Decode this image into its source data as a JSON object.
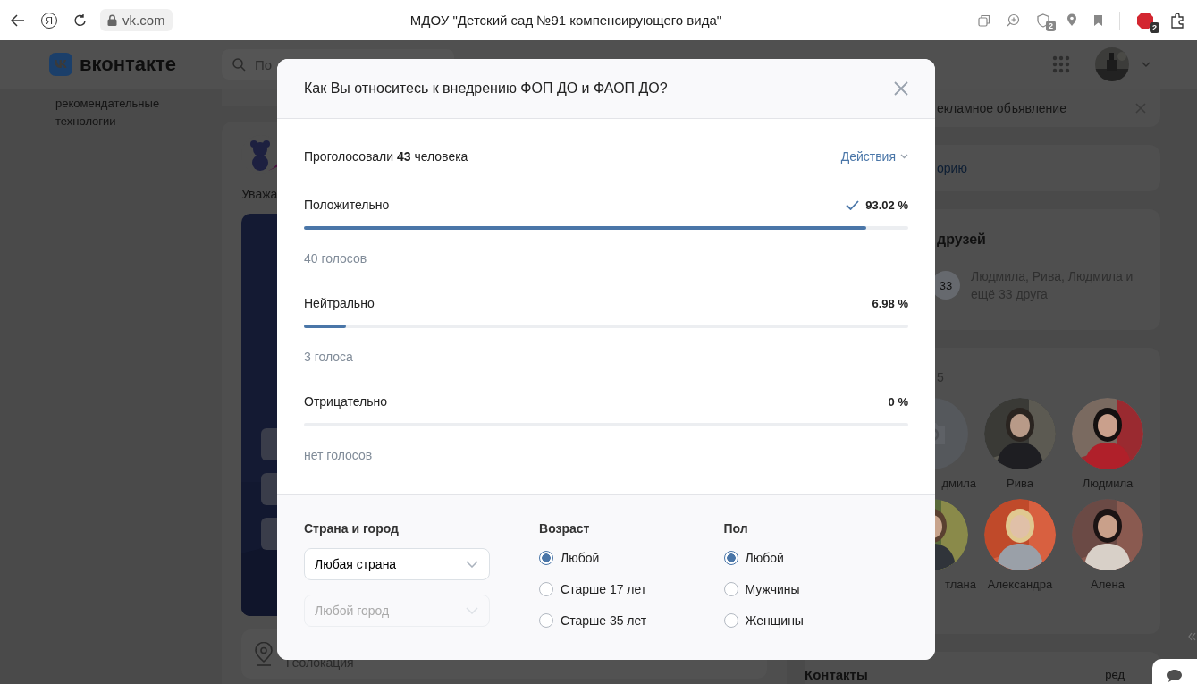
{
  "browser": {
    "home_glyph": "Я",
    "address": "vk.com",
    "title": "МДОУ \"Детский сад №91 компенсирующего вида\"",
    "shield_badge": "2",
    "extension_badge": "2"
  },
  "vk_header": {
    "logo": "вконтакте",
    "search_placeholder": "По"
  },
  "left_note": "рекомендательные технологии",
  "feed": {
    "author_snippet": "Уважа",
    "geo_label": "Геолокация"
  },
  "right": {
    "ad_text": "екламное объявление",
    "story_link": "орию",
    "friends_title": "друзей",
    "more_badge": "33",
    "friends_names": "Людмила, Рива, Людмила и ещё 33 друга",
    "friends_count": "5",
    "friends": [
      {
        "name": "дмила",
        "kind": "placeholder"
      },
      {
        "name": "Рива"
      },
      {
        "name": "Людмила"
      },
      {
        "name": "тлана"
      },
      {
        "name": "Александра"
      },
      {
        "name": "Алена"
      }
    ],
    "contacts_title": "Контакты",
    "contacts_edit": "ред"
  },
  "poll": {
    "question": "Как Вы относитесь к внедрению ФОП ДО и ФАОП ДО?",
    "summary": "Проголосовали **43** человека",
    "actions": "Действия",
    "answers": [
      {
        "label": "Положительно",
        "percent": "93.02 %",
        "level": 0.9302,
        "votes": "40 голосов",
        "voted": true
      },
      {
        "label": "Нейтрально",
        "percent": "6.98 %",
        "level": 0.0698,
        "votes": "3 голоса",
        "voted": false
      },
      {
        "label": "Отрицательно",
        "percent": "0 %",
        "level": 0,
        "votes": "нет голосов",
        "voted": false
      }
    ],
    "filters": {
      "location": {
        "title": "Страна и город",
        "selects": [
          {
            "value": "Любая страна",
            "disabled": false
          },
          {
            "value": "Любой город",
            "disabled": true
          }
        ]
      },
      "age": {
        "title": "Возраст",
        "options": [
          {
            "label": "Любой",
            "selected": true
          },
          {
            "label": "Старше 17 лет",
            "selected": false
          },
          {
            "label": "Старше 35 лет",
            "selected": false
          }
        ]
      },
      "gender": {
        "title": "Пол",
        "options": [
          {
            "label": "Любой",
            "selected": true
          },
          {
            "label": "Мужчины",
            "selected": false
          },
          {
            "label": "Женщины",
            "selected": false
          }
        ]
      }
    }
  }
}
